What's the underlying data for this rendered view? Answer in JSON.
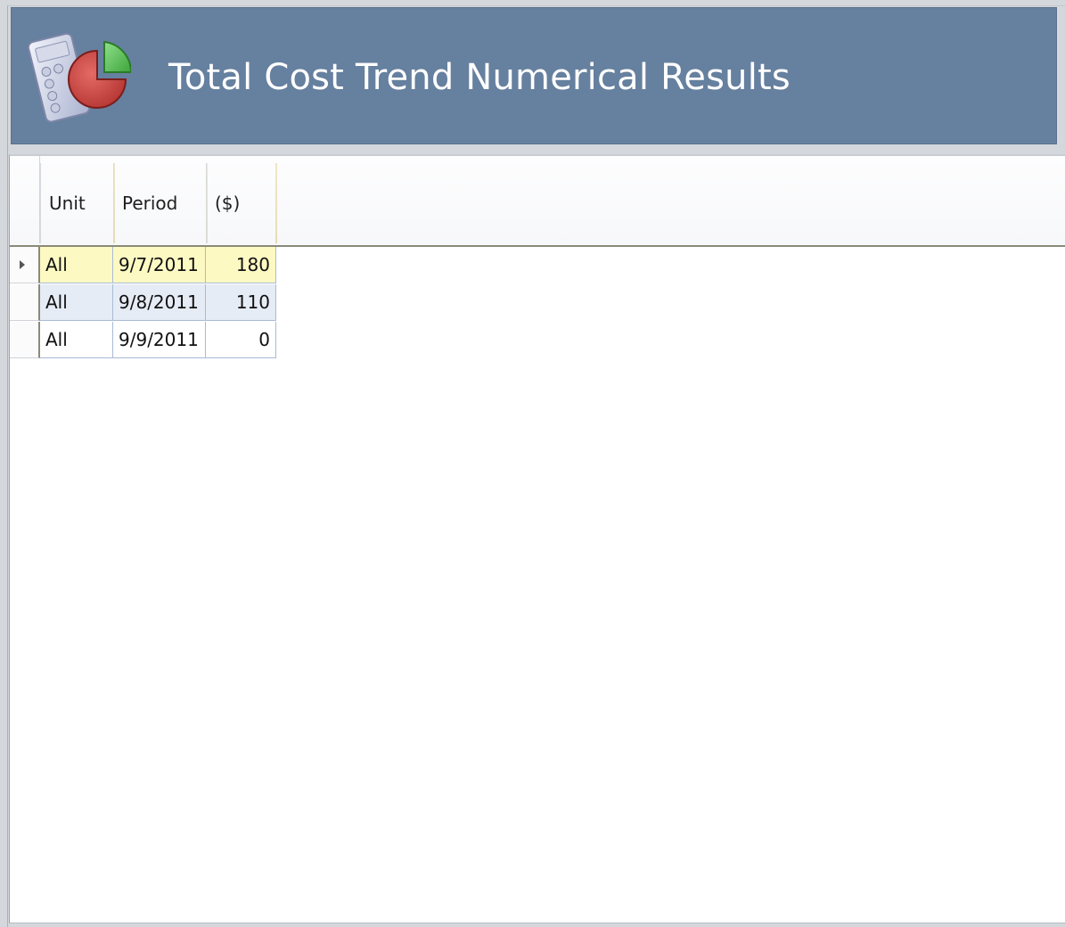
{
  "header": {
    "title": "Total Cost Trend Numerical Results",
    "icon": "calculator-pie-chart-icon"
  },
  "grid": {
    "columns": [
      "Unit",
      "Period",
      "($)"
    ],
    "rows": [
      {
        "unit": "All",
        "period": "9/7/2011",
        "cost": "180",
        "selected": true
      },
      {
        "unit": "All",
        "period": "9/8/2011",
        "cost": "110",
        "selected": false
      },
      {
        "unit": "All",
        "period": "9/9/2011",
        "cost": "0",
        "selected": false
      }
    ]
  },
  "colors": {
    "header_bg": "#66809f",
    "selected_row": "#fdf9c3",
    "alt_row": "#e6ecf5",
    "grid_line": "#a8bbd6"
  }
}
